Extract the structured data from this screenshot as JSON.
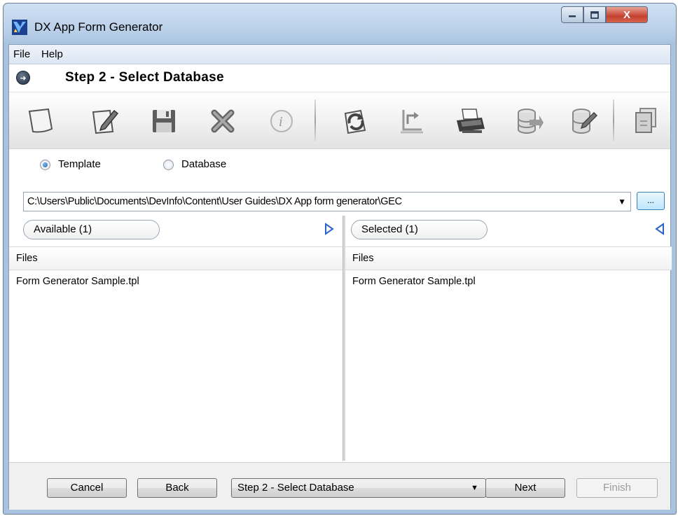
{
  "window": {
    "title": "DX App Form Generator",
    "close_glyph": "X"
  },
  "menu": {
    "items": [
      {
        "label": "File"
      },
      {
        "label": "Help"
      }
    ]
  },
  "step_header": {
    "title": "Step 2 - Select Database"
  },
  "toolbar": {
    "icons": [
      "new-icon",
      "edit-icon",
      "save-icon",
      "delete-icon",
      "info-icon",
      "refresh-icon",
      "import-icon",
      "print-icon",
      "database-export-icon",
      "database-edit-icon",
      "window-icon"
    ]
  },
  "source": {
    "options": [
      {
        "label": "Template",
        "checked": true
      },
      {
        "label": "Database",
        "checked": false
      }
    ]
  },
  "path": {
    "value": "C:\\Users\\Public\\Documents\\DevInfo\\Content\\User Guides\\DX App form generator\\GEC",
    "browse_label": "..."
  },
  "available": {
    "label": "Available (1)",
    "column": "Files",
    "files": [
      "Form Generator Sample.tpl"
    ]
  },
  "selected": {
    "label": "Selected (1)",
    "column": "Files",
    "files": [
      "Form Generator Sample.tpl"
    ]
  },
  "footer": {
    "cancel": "Cancel",
    "back": "Back",
    "step_select": "Step 2 - Select Database",
    "next": "Next",
    "finish": "Finish"
  },
  "colors": {
    "title_gradient": "#b9cfe8",
    "close_red": "#c4402e",
    "arrow_blue": "#2a63c9"
  }
}
